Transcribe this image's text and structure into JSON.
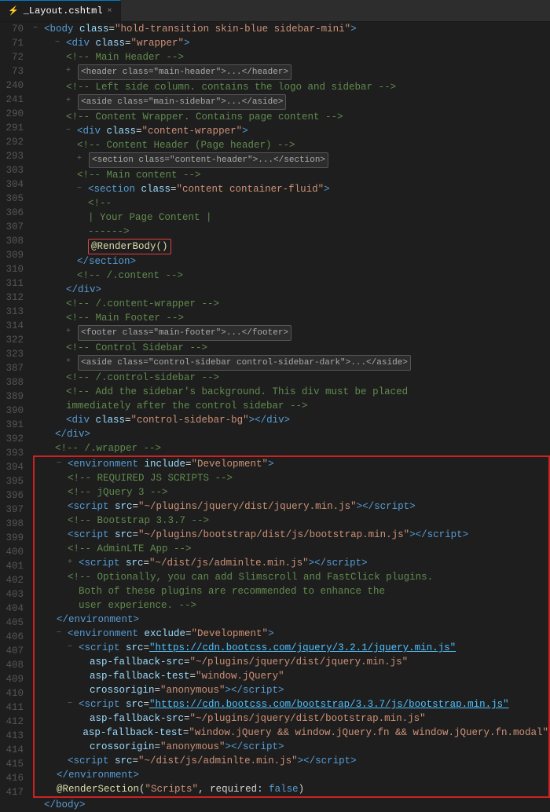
{
  "tab": {
    "filename": "_Layout.cshtml",
    "icon": "⚡",
    "close_label": "×"
  },
  "lines": [
    {
      "num": 70,
      "indent": 0,
      "collapse": "-",
      "content": "<body_open>"
    },
    {
      "num": 71,
      "indent": 1,
      "collapse": "-",
      "content": "<div_wrapper>"
    },
    {
      "num": 72,
      "indent": 2,
      "collapse": null,
      "content": "comment_main_header"
    },
    {
      "num": 73,
      "indent": 2,
      "collapse": "+",
      "content": "<header_folded>"
    },
    {
      "num": 240,
      "indent": 2,
      "collapse": null,
      "content": "comment_left_side"
    },
    {
      "num": 241,
      "indent": 2,
      "collapse": "+",
      "content": "<aside_folded>"
    },
    {
      "num": 290,
      "indent": 2,
      "collapse": null,
      "content": "comment_content_wrapper"
    },
    {
      "num": 291,
      "indent": 2,
      "collapse": "-",
      "content": "<div_content_wrapper>"
    },
    {
      "num": 292,
      "indent": 3,
      "collapse": null,
      "content": "comment_content_header"
    },
    {
      "num": 293,
      "indent": 3,
      "collapse": "+",
      "content": "<section_content_header>"
    },
    {
      "num": 303,
      "indent": 3,
      "collapse": null,
      "content": "comment_main_content"
    },
    {
      "num": 304,
      "indent": 3,
      "collapse": "-",
      "content": "<section_content_container>"
    },
    {
      "num": 305,
      "indent": 4,
      "collapse": null,
      "content": "comment_dashes1"
    },
    {
      "num": 306,
      "indent": 4,
      "collapse": null,
      "content": "comment_your_page"
    },
    {
      "num": 307,
      "indent": 4,
      "collapse": null,
      "content": "comment_dashes2"
    },
    {
      "num": 308,
      "indent": 4,
      "collapse": null,
      "content": "render_body"
    },
    {
      "num": 309,
      "indent": 3,
      "collapse": null,
      "content": "</section>"
    },
    {
      "num": 310,
      "indent": 3,
      "collapse": null,
      "content": "comment_content_end"
    },
    {
      "num": 311,
      "indent": 2,
      "collapse": null,
      "content": "</div>"
    },
    {
      "num": 312,
      "indent": 2,
      "collapse": null,
      "content": "comment_content_wrapper_end"
    },
    {
      "num": 313,
      "indent": 2,
      "collapse": null,
      "content": "comment_main_footer"
    },
    {
      "num": 314,
      "indent": 2,
      "collapse": "+",
      "content": "<footer_folded>"
    },
    {
      "num": 322,
      "indent": 2,
      "collapse": null,
      "content": "comment_control_sidebar"
    },
    {
      "num": 323,
      "indent": 2,
      "collapse": "+",
      "content": "<aside_control_folded>"
    },
    {
      "num": 387,
      "indent": 2,
      "collapse": null,
      "content": "comment_control_sidebar_end"
    },
    {
      "num": 388,
      "indent": 2,
      "collapse": null,
      "content": "comment_add_sidebar_bg"
    },
    {
      "num": 389,
      "indent": 2,
      "collapse": null,
      "content": "comment_immediately"
    },
    {
      "num": 390,
      "indent": 2,
      "collapse": null,
      "content": "<div_control_sidebar_bg>"
    },
    {
      "num": 391,
      "indent": 1,
      "collapse": null,
      "content": "</div>"
    },
    {
      "num": 392,
      "indent": 1,
      "collapse": null,
      "content": "comment_wrapper_end"
    },
    {
      "num": 393,
      "indent": 1,
      "collapse": "-",
      "content": "<environment_development>"
    },
    {
      "num": 394,
      "indent": 2,
      "collapse": null,
      "content": "comment_required_js"
    },
    {
      "num": 395,
      "indent": 2,
      "collapse": null,
      "content": "comment_jquery3"
    },
    {
      "num": 396,
      "indent": 2,
      "collapse": null,
      "content": "script_jquery"
    },
    {
      "num": 397,
      "indent": 2,
      "collapse": null,
      "content": "comment_bootstrap"
    },
    {
      "num": 398,
      "indent": 2,
      "collapse": null,
      "content": "script_bootstrap"
    },
    {
      "num": 399,
      "indent": 2,
      "collapse": null,
      "content": "comment_adminlte"
    },
    {
      "num": 400,
      "indent": 2,
      "collapse": null,
      "content": "script_adminlte"
    },
    {
      "num": 401,
      "indent": 2,
      "collapse": null,
      "content": "comment_optionally"
    },
    {
      "num": 402,
      "indent": 3,
      "collapse": null,
      "content": "comment_both_plugins"
    },
    {
      "num": 403,
      "indent": 3,
      "collapse": null,
      "content": "comment_user_experience"
    },
    {
      "num": 404,
      "indent": 2,
      "collapse": null,
      "content": "</environment>"
    },
    {
      "num": 405,
      "indent": 1,
      "collapse": "-",
      "content": "<environment_exclude>"
    },
    {
      "num": 406,
      "indent": 2,
      "collapse": "-",
      "content": "script_jquery_cdn"
    },
    {
      "num": 407,
      "indent": 3,
      "collapse": null,
      "content": "asp_fallback_jquery"
    },
    {
      "num": 408,
      "indent": 3,
      "collapse": null,
      "content": "asp_fallback_test_jquery"
    },
    {
      "num": 409,
      "indent": 3,
      "collapse": null,
      "content": "crossorigin_script_close"
    },
    {
      "num": 410,
      "indent": 2,
      "collapse": "-",
      "content": "script_bootstrap_cdn"
    },
    {
      "num": 411,
      "indent": 3,
      "collapse": null,
      "content": "asp_fallback_bootstrap"
    },
    {
      "num": 412,
      "indent": 3,
      "collapse": null,
      "content": "asp_fallback_test_bootstrap"
    },
    {
      "num": 413,
      "indent": 3,
      "collapse": null,
      "content": "crossorigin_anonymous_close"
    },
    {
      "num": 414,
      "indent": 2,
      "collapse": null,
      "content": "script_adminlte_min"
    },
    {
      "num": 415,
      "indent": 1,
      "collapse": null,
      "content": "</environment_end>"
    },
    {
      "num": 416,
      "indent": 1,
      "collapse": null,
      "content": "render_section"
    },
    {
      "num": 417,
      "indent": 0,
      "collapse": null,
      "content": "</body>"
    }
  ]
}
